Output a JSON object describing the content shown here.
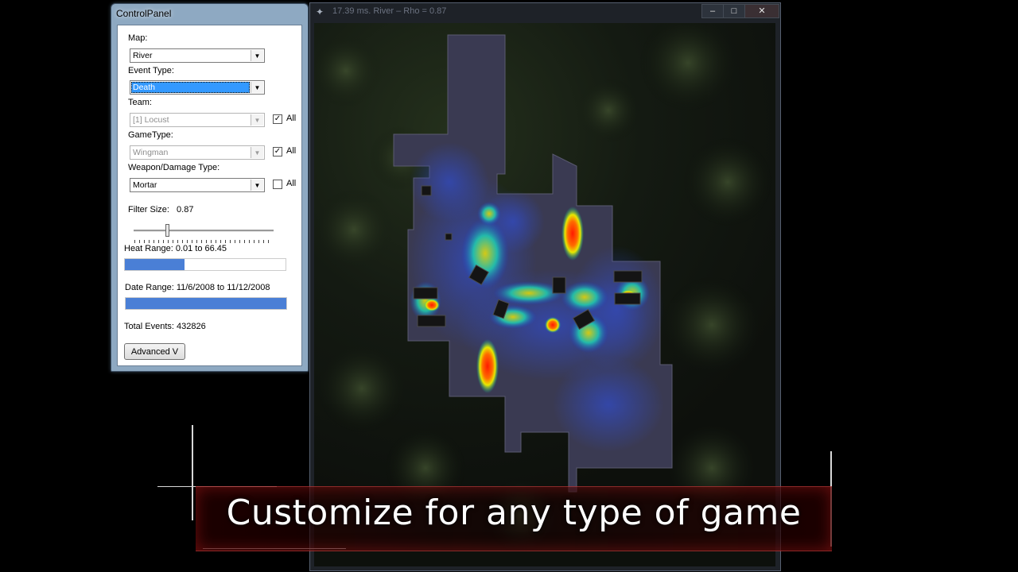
{
  "control_panel": {
    "title": "ControlPanel",
    "map": {
      "label": "Map:",
      "value": "River"
    },
    "event_type": {
      "label": "Event Type:",
      "value": "Death"
    },
    "team": {
      "label": "Team:",
      "value": "[1] Locust",
      "all_label": "All",
      "all_checked": true
    },
    "game_type": {
      "label": "GameType:",
      "value": "Wingman",
      "all_label": "All",
      "all_checked": true
    },
    "weapon": {
      "label": "Weapon/Damage Type:",
      "value": "Mortar",
      "all_label": "All",
      "all_checked": false
    },
    "filter_size": {
      "label": "Filter Size:",
      "value": "0.87"
    },
    "heat_range": {
      "label": "Heat Range: 0.01 to 66.45",
      "fill_fraction": 0.37
    },
    "date_range": {
      "label": "Date Range: 11/6/2008 to 11/12/2008",
      "fill_fraction": 1.0
    },
    "total_events": "Total Events: 432826",
    "advanced_button": "Advanced V"
  },
  "heatmap_window": {
    "title": "17.39 ms. River – Rho = 0.87",
    "app_icon": "pin-icon",
    "minimize": "–",
    "maximize": "□",
    "close": "✕"
  },
  "caption": "Customize for any type of game",
  "colors": {
    "accent_blue": "#3399ff",
    "bar_blue": "#4a7fd6",
    "heat_hot": "#ff2a00",
    "heat_cool": "#3b4fd8"
  }
}
